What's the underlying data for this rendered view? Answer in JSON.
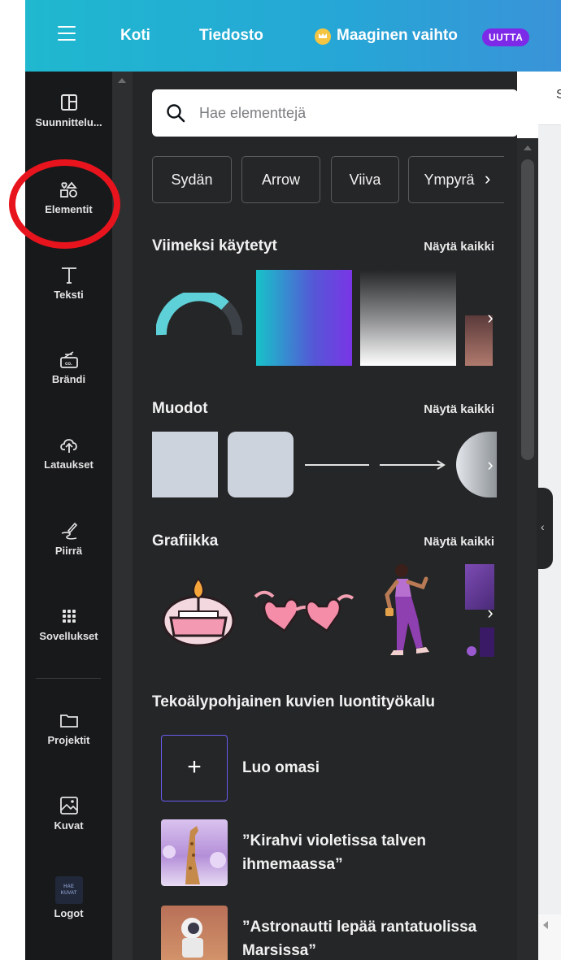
{
  "topbar": {
    "home": "Koti",
    "file": "Tiedosto",
    "magic_switch": "Maaginen vaihto",
    "badge_new": "UUTTA"
  },
  "sidebar": {
    "items": [
      {
        "label": "Suunnittelu...",
        "icon": "layout-icon"
      },
      {
        "label": "Elementit",
        "icon": "elements-icon"
      },
      {
        "label": "Teksti",
        "icon": "text-icon"
      },
      {
        "label": "Brändi",
        "icon": "brand-icon"
      },
      {
        "label": "Lataukset",
        "icon": "upload-icon"
      },
      {
        "label": "Piirrä",
        "icon": "draw-icon"
      },
      {
        "label": "Sovellukset",
        "icon": "apps-icon"
      },
      {
        "label": "Projektit",
        "icon": "folder-icon"
      },
      {
        "label": "Kuvat",
        "icon": "image-icon"
      },
      {
        "label": "Logot",
        "icon": "logo-icon"
      }
    ],
    "logo_thumb_text": "HAE KUVAT"
  },
  "panel": {
    "search_placeholder": "Hae elementtejä",
    "chips": [
      "Sydän",
      "Arrow",
      "Viiva",
      "Ympyrä"
    ],
    "recent_title": "Viimeksi käytetyt",
    "shapes_title": "Muodot",
    "graphics_title": "Grafiikka",
    "see_all": "Näytä kaikki",
    "ai_title": "Tekoälypohjainen kuvien luontityökalu",
    "ai_create": "Luo omasi",
    "ai_prompts": [
      "”Kirahvi violetissa talven ihmemaassa”",
      "”Astronautti lepää rantatuolissa Marsissa”"
    ]
  },
  "canvas": {
    "tab_letter": "S"
  },
  "colors": {
    "accent": "#7d2ae8",
    "highlight_ring": "#e8141d",
    "panel_bg": "#252627",
    "rail_bg": "#18191b"
  }
}
